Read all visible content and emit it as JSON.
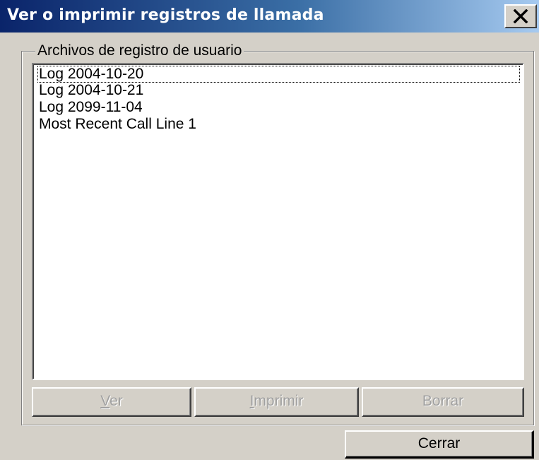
{
  "window": {
    "title": "Ver o imprimir registros de llamada",
    "close_icon": "close-icon"
  },
  "group": {
    "label": "Archivos de registro de usuario"
  },
  "list": {
    "items": [
      "Log 2004-10-20",
      "Log 2004-10-21",
      "Log 2099-11-04",
      "Most Recent Call Line 1"
    ]
  },
  "buttons": {
    "ver": {
      "mnemonic": "V",
      "rest": "er"
    },
    "imprimir": {
      "mnemonic": "I",
      "rest": "mprimir"
    },
    "borrar": "Borrar",
    "cerrar": "Cerrar"
  },
  "colors": {
    "title_start": "#0a246a",
    "title_end": "#a6caf0",
    "face": "#d4d0c8",
    "disabled_text": "#a0a0a0"
  }
}
